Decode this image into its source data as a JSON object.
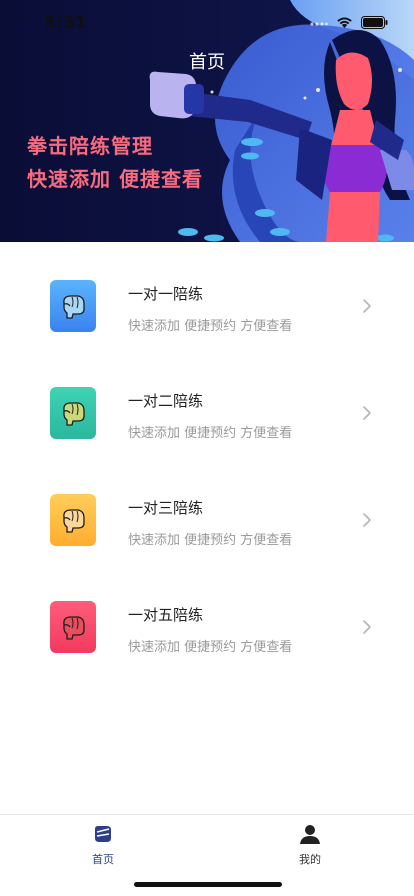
{
  "status_bar": {
    "time": "5:31"
  },
  "header": {
    "title": "首页",
    "slogan_line1": "拳击陪练管理",
    "slogan_line2": "快速添加 便捷查看"
  },
  "colors": {
    "banner_bg": "#0b0f3a",
    "slogan": "#f86a7e",
    "tab_active": "#2c3e8c"
  },
  "items": [
    {
      "title": "一对一陪练",
      "subtitle": "快速添加 便捷预约 方便查看",
      "icon": "boxing-glove-icon",
      "color_top": "#5ab4fb",
      "color_bottom": "#3a82f0",
      "glove": "#a8d8f4"
    },
    {
      "title": "一对二陪练",
      "subtitle": "快速添加 便捷预约 方便查看",
      "icon": "boxing-glove-icon",
      "color_top": "#3fd3b3",
      "color_bottom": "#2ab79e",
      "glove": "#c9d97a"
    },
    {
      "title": "一对三陪练",
      "subtitle": "快速添加 便捷预约 方便查看",
      "icon": "boxing-glove-icon",
      "color_top": "#ffce5a",
      "color_bottom": "#ffad2f",
      "glove": "#fbd79a"
    },
    {
      "title": "一对五陪练",
      "subtitle": "快速添加 便捷预约 方便查看",
      "icon": "boxing-glove-icon",
      "color_top": "#ff5d7a",
      "color_bottom": "#f23a5e",
      "glove": "#e74f5c"
    }
  ],
  "tabbar": {
    "home_label": "首页",
    "mine_label": "我的"
  }
}
